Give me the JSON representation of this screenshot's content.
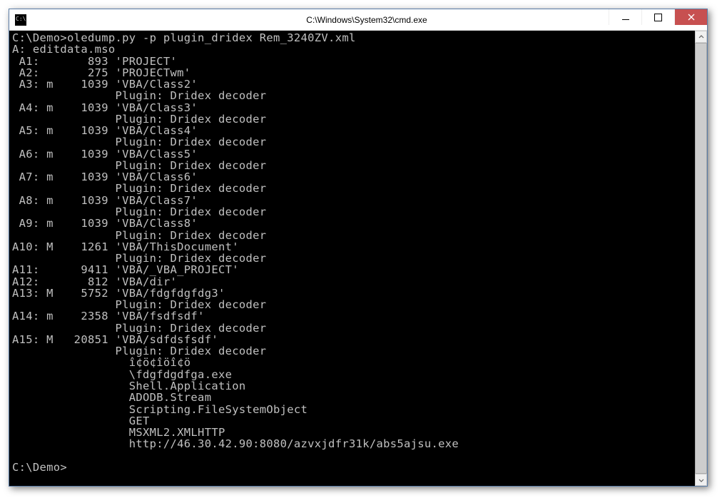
{
  "window": {
    "title": "C:\\Windows\\System32\\cmd.exe"
  },
  "terminal": {
    "lines": [
      "C:\\Demo>oledump.py -p plugin_dridex Rem_3240ZV.xml",
      "A: editdata.mso",
      " A1:       893 'PROJECT'",
      " A2:       275 'PROJECTwm'",
      " A3: m    1039 'VBA/Class2'",
      "               Plugin: Dridex decoder",
      " A4: m    1039 'VBA/Class3'",
      "               Plugin: Dridex decoder",
      " A5: m    1039 'VBA/Class4'",
      "               Plugin: Dridex decoder",
      " A6: m    1039 'VBA/Class5'",
      "               Plugin: Dridex decoder",
      " A7: m    1039 'VBA/Class6'",
      "               Plugin: Dridex decoder",
      " A8: m    1039 'VBA/Class7'",
      "               Plugin: Dridex decoder",
      " A9: m    1039 'VBA/Class8'",
      "               Plugin: Dridex decoder",
      "A10: M    1261 'VBA/ThisDocument'",
      "               Plugin: Dridex decoder",
      "A11:      9411 'VBA/_VBA_PROJECT'",
      "A12:       812 'VBA/dir'",
      "A13: M    5752 'VBA/fdgfdgfdg3'",
      "               Plugin: Dridex decoder",
      "A14: m    2358 'VBA/fsdfsdf'",
      "               Plugin: Dridex decoder",
      "A15: M   20851 'VBA/sdfdsfsdf'",
      "               Plugin: Dridex decoder",
      "                 î¢ö¢îöî¢ö",
      "                 \\fdgfdgdfga.exe",
      "                 Shell.Application",
      "                 ADODB.Stream",
      "                 Scripting.FileSystemObject",
      "                 GET",
      "                 MSXML2.XMLHTTP",
      "                 http://46.30.42.90:8080/azvxjdfr31k/abs5ajsu.exe",
      "",
      "C:\\Demo>"
    ]
  }
}
